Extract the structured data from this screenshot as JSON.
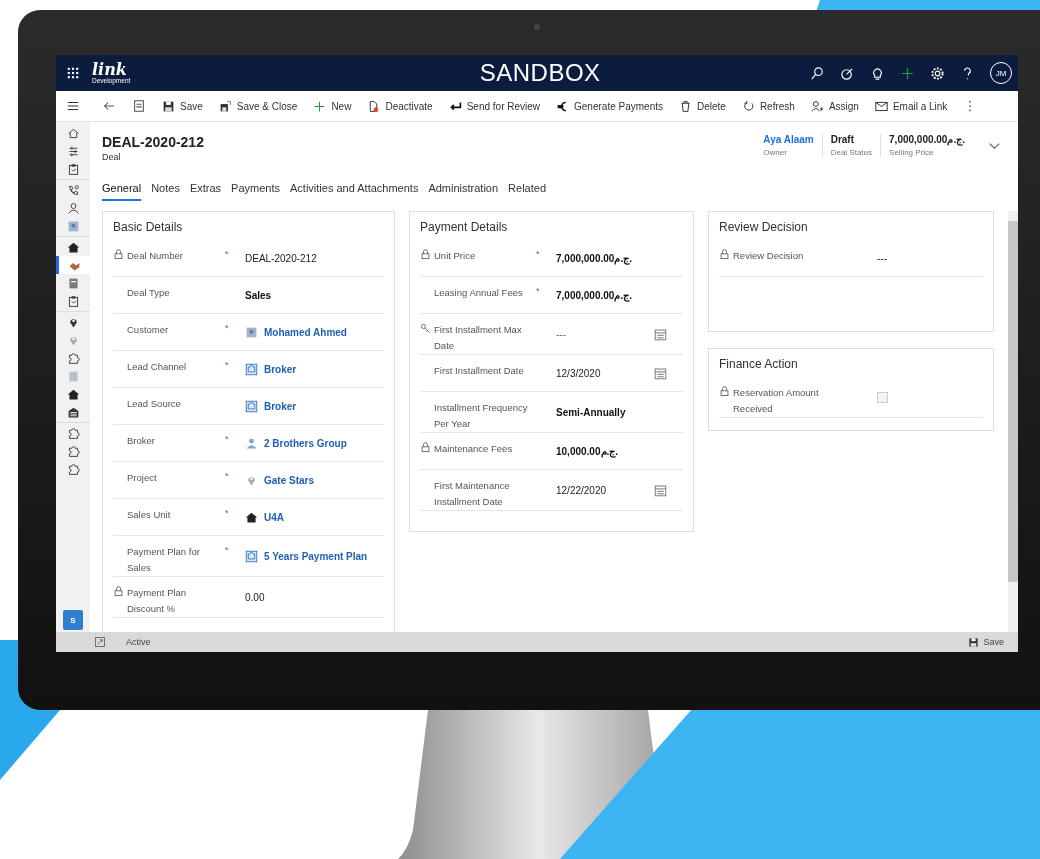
{
  "nav": {
    "logo": "link",
    "logo_subtitle": "Development",
    "title": "SANDBOX",
    "avatar": "JM"
  },
  "commands": [
    "Save",
    "Save & Close",
    "New",
    "Deactivate",
    "Send for Review",
    "Generate Payments",
    "Delete",
    "Refresh",
    "Assign",
    "Email a Link"
  ],
  "sidebar": {
    "items": [
      {
        "selected": false
      },
      {
        "selected": false
      },
      {
        "selected": false
      },
      {
        "selected": false
      },
      {
        "selected": false
      },
      {
        "selected": false
      },
      {
        "selected": false
      },
      {
        "selected": true
      },
      {
        "selected": false
      },
      {
        "selected": false
      },
      {
        "selected": false
      },
      {
        "selected": false
      },
      {
        "selected": false
      },
      {
        "selected": false
      },
      {
        "selected": false
      },
      {
        "selected": false
      },
      {
        "selected": false
      },
      {
        "selected": false
      },
      {
        "selected": false
      }
    ],
    "area_badge": "S"
  },
  "header": {
    "title": "DEAL-2020-212",
    "entity": "Deal",
    "fields": [
      {
        "value": "Aya Alaam",
        "label": "Owner",
        "kind": "link"
      },
      {
        "value": "Draft",
        "label": "Deal Status",
        "kind": "text"
      },
      {
        "value": "7,000,000.00ج.م.",
        "label": "Selling Price",
        "kind": "text"
      }
    ]
  },
  "tabs": [
    {
      "label": "General",
      "selected": true
    },
    {
      "label": "Notes",
      "selected": false
    },
    {
      "label": "Extras",
      "selected": false
    },
    {
      "label": "Payments",
      "selected": false
    },
    {
      "label": "Activities and Attachments",
      "selected": false
    },
    {
      "label": "Administration",
      "selected": false
    },
    {
      "label": "Related",
      "selected": false
    }
  ],
  "columns": [
    [
      {
        "title": "Basic Details",
        "fields": [
          {
            "label": "Deal Number",
            "locked": true,
            "required_mark": "*",
            "kind": "text",
            "value": "DEAL-2020-212"
          },
          {
            "label": "Deal Type",
            "locked": false,
            "kind": "strong",
            "value": "Sales"
          },
          {
            "label": "Customer",
            "locked": false,
            "required_mark": "*",
            "kind": "link",
            "value": "Mohamed Ahmed"
          },
          {
            "label": "Lead Channel",
            "locked": false,
            "required_mark": "*",
            "kind": "link",
            "value": "Broker"
          },
          {
            "label": "Lead Source",
            "locked": false,
            "kind": "link",
            "value": "Broker"
          },
          {
            "label": "Broker",
            "locked": false,
            "required_mark": "*",
            "kind": "link",
            "value": "2 Brothers Group"
          },
          {
            "label": "Project",
            "locked": false,
            "required_mark": "*",
            "kind": "link",
            "value": "Gate Stars"
          },
          {
            "label": "Sales Unit",
            "locked": false,
            "required_mark": "*",
            "kind": "link",
            "value": "U4A"
          },
          {
            "label": "Payment Plan for Sales",
            "locked": false,
            "required_mark": "*",
            "kind": "link",
            "value": "5 Years Payment Plan"
          },
          {
            "label": "Payment Plan Discount %",
            "locked": true,
            "kind": "text",
            "value": "0.00"
          }
        ]
      }
    ],
    [
      {
        "title": "Payment Details",
        "fields": [
          {
            "label": "Unit Price",
            "locked": true,
            "required_mark": "*",
            "kind": "strong",
            "value": "7,000,000.00ج.م."
          },
          {
            "label": "Leasing Annual Fees",
            "locked": false,
            "required_mark": "*",
            "kind": "strong",
            "value": "7,000,000.00ج.م."
          },
          {
            "label": "First Installment Max Date",
            "locked": false,
            "kind": "date",
            "value": "---"
          },
          {
            "label": "First Installment Date",
            "locked": false,
            "kind": "date",
            "value": "12/3/2020"
          },
          {
            "label": "Installment Frequency Per Year",
            "locked": false,
            "kind": "strong",
            "value": "Semi-Annually"
          },
          {
            "label": "Maintenance Fees",
            "locked": true,
            "kind": "strong",
            "value": "10,000.00ج.م."
          },
          {
            "label": "First Maintenance Installment Date",
            "locked": false,
            "kind": "date",
            "value": "12/22/2020"
          }
        ]
      }
    ],
    [
      {
        "title": "Review Decision",
        "fields": [
          {
            "label": "Review Decision",
            "locked": true,
            "kind": "text",
            "value": "---"
          }
        ]
      },
      {
        "title": "Finance Action",
        "fields": [
          {
            "label": "Reservation Amount Received",
            "locked": true,
            "kind": "checkbox",
            "checked": false
          }
        ]
      }
    ]
  ],
  "status_bar": {
    "status": "Active",
    "save": "Save"
  }
}
